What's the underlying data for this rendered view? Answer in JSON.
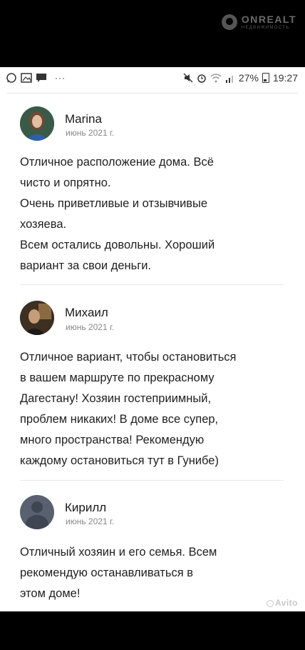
{
  "watermark": {
    "brand": "ONREALT",
    "tagline": "НЕДВИЖИМОСТЬ"
  },
  "status_bar": {
    "left_icons": [
      "whatsapp-icon",
      "image-icon",
      "message-icon"
    ],
    "ellipsis": "···",
    "battery": "27%",
    "time": "19:27"
  },
  "reviews": [
    {
      "author": "Marina",
      "date": "июнь 2021 г.",
      "lines": [
        "Отличное расположение дома. Всё",
        "чисто и опрятно.",
        "Очень приветливые и отзывчивые",
        "хозяева.",
        "Всем остались довольны. Хороший",
        "вариант за свои деньги."
      ]
    },
    {
      "author": "Михаил",
      "date": "июнь 2021 г.",
      "lines": [
        "Отличное вариант, чтобы остановиться",
        "в вашем маршруте по прекрасному",
        "Дагестану! Хозяин гостеприимный,",
        "проблем никаких! В доме все супер,",
        "много пространства! Рекомендую",
        "каждому остановиться тут в Гунибе)"
      ]
    },
    {
      "author": "Кирилл",
      "date": "июнь 2021 г.",
      "lines": [
        "Отличный хозяин и его семья. Всем",
        "рекомендую останавливаться в",
        "этом доме!"
      ]
    }
  ],
  "avito_watermark": "Avito"
}
